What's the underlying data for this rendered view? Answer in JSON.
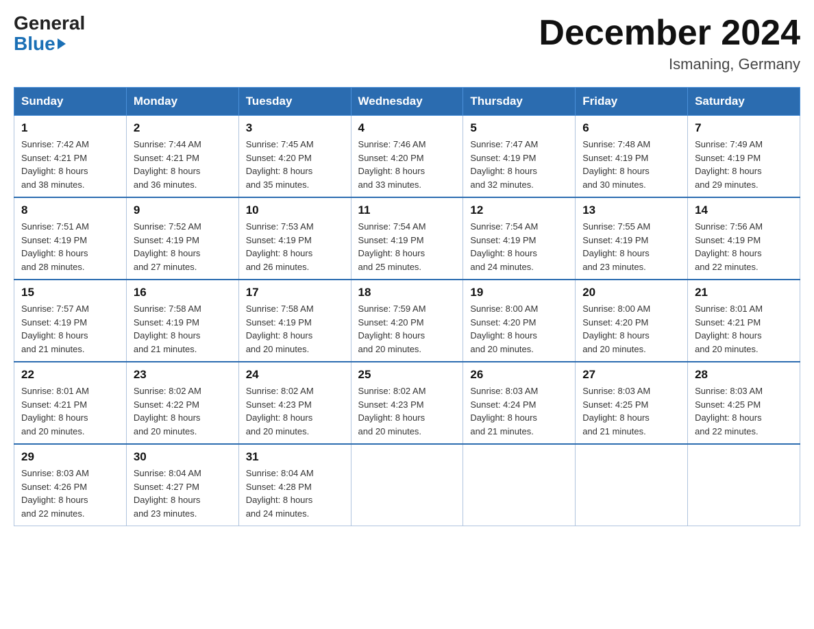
{
  "logo": {
    "general": "General",
    "blue": "Blue"
  },
  "title": "December 2024",
  "location": "Ismaning, Germany",
  "days_of_week": [
    "Sunday",
    "Monday",
    "Tuesday",
    "Wednesday",
    "Thursday",
    "Friday",
    "Saturday"
  ],
  "weeks": [
    [
      {
        "day": "1",
        "info": "Sunrise: 7:42 AM\nSunset: 4:21 PM\nDaylight: 8 hours\nand 38 minutes."
      },
      {
        "day": "2",
        "info": "Sunrise: 7:44 AM\nSunset: 4:21 PM\nDaylight: 8 hours\nand 36 minutes."
      },
      {
        "day": "3",
        "info": "Sunrise: 7:45 AM\nSunset: 4:20 PM\nDaylight: 8 hours\nand 35 minutes."
      },
      {
        "day": "4",
        "info": "Sunrise: 7:46 AM\nSunset: 4:20 PM\nDaylight: 8 hours\nand 33 minutes."
      },
      {
        "day": "5",
        "info": "Sunrise: 7:47 AM\nSunset: 4:19 PM\nDaylight: 8 hours\nand 32 minutes."
      },
      {
        "day": "6",
        "info": "Sunrise: 7:48 AM\nSunset: 4:19 PM\nDaylight: 8 hours\nand 30 minutes."
      },
      {
        "day": "7",
        "info": "Sunrise: 7:49 AM\nSunset: 4:19 PM\nDaylight: 8 hours\nand 29 minutes."
      }
    ],
    [
      {
        "day": "8",
        "info": "Sunrise: 7:51 AM\nSunset: 4:19 PM\nDaylight: 8 hours\nand 28 minutes."
      },
      {
        "day": "9",
        "info": "Sunrise: 7:52 AM\nSunset: 4:19 PM\nDaylight: 8 hours\nand 27 minutes."
      },
      {
        "day": "10",
        "info": "Sunrise: 7:53 AM\nSunset: 4:19 PM\nDaylight: 8 hours\nand 26 minutes."
      },
      {
        "day": "11",
        "info": "Sunrise: 7:54 AM\nSunset: 4:19 PM\nDaylight: 8 hours\nand 25 minutes."
      },
      {
        "day": "12",
        "info": "Sunrise: 7:54 AM\nSunset: 4:19 PM\nDaylight: 8 hours\nand 24 minutes."
      },
      {
        "day": "13",
        "info": "Sunrise: 7:55 AM\nSunset: 4:19 PM\nDaylight: 8 hours\nand 23 minutes."
      },
      {
        "day": "14",
        "info": "Sunrise: 7:56 AM\nSunset: 4:19 PM\nDaylight: 8 hours\nand 22 minutes."
      }
    ],
    [
      {
        "day": "15",
        "info": "Sunrise: 7:57 AM\nSunset: 4:19 PM\nDaylight: 8 hours\nand 21 minutes."
      },
      {
        "day": "16",
        "info": "Sunrise: 7:58 AM\nSunset: 4:19 PM\nDaylight: 8 hours\nand 21 minutes."
      },
      {
        "day": "17",
        "info": "Sunrise: 7:58 AM\nSunset: 4:19 PM\nDaylight: 8 hours\nand 20 minutes."
      },
      {
        "day": "18",
        "info": "Sunrise: 7:59 AM\nSunset: 4:20 PM\nDaylight: 8 hours\nand 20 minutes."
      },
      {
        "day": "19",
        "info": "Sunrise: 8:00 AM\nSunset: 4:20 PM\nDaylight: 8 hours\nand 20 minutes."
      },
      {
        "day": "20",
        "info": "Sunrise: 8:00 AM\nSunset: 4:20 PM\nDaylight: 8 hours\nand 20 minutes."
      },
      {
        "day": "21",
        "info": "Sunrise: 8:01 AM\nSunset: 4:21 PM\nDaylight: 8 hours\nand 20 minutes."
      }
    ],
    [
      {
        "day": "22",
        "info": "Sunrise: 8:01 AM\nSunset: 4:21 PM\nDaylight: 8 hours\nand 20 minutes."
      },
      {
        "day": "23",
        "info": "Sunrise: 8:02 AM\nSunset: 4:22 PM\nDaylight: 8 hours\nand 20 minutes."
      },
      {
        "day": "24",
        "info": "Sunrise: 8:02 AM\nSunset: 4:23 PM\nDaylight: 8 hours\nand 20 minutes."
      },
      {
        "day": "25",
        "info": "Sunrise: 8:02 AM\nSunset: 4:23 PM\nDaylight: 8 hours\nand 20 minutes."
      },
      {
        "day": "26",
        "info": "Sunrise: 8:03 AM\nSunset: 4:24 PM\nDaylight: 8 hours\nand 21 minutes."
      },
      {
        "day": "27",
        "info": "Sunrise: 8:03 AM\nSunset: 4:25 PM\nDaylight: 8 hours\nand 21 minutes."
      },
      {
        "day": "28",
        "info": "Sunrise: 8:03 AM\nSunset: 4:25 PM\nDaylight: 8 hours\nand 22 minutes."
      }
    ],
    [
      {
        "day": "29",
        "info": "Sunrise: 8:03 AM\nSunset: 4:26 PM\nDaylight: 8 hours\nand 22 minutes."
      },
      {
        "day": "30",
        "info": "Sunrise: 8:04 AM\nSunset: 4:27 PM\nDaylight: 8 hours\nand 23 minutes."
      },
      {
        "day": "31",
        "info": "Sunrise: 8:04 AM\nSunset: 4:28 PM\nDaylight: 8 hours\nand 24 minutes."
      },
      {
        "day": "",
        "info": ""
      },
      {
        "day": "",
        "info": ""
      },
      {
        "day": "",
        "info": ""
      },
      {
        "day": "",
        "info": ""
      }
    ]
  ]
}
